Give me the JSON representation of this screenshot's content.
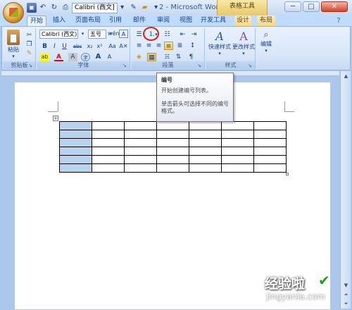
{
  "titlebar": {
    "title": "2 - Microsoft Word",
    "font_name": "Calibri (西文]",
    "context_tools": "表格工具",
    "minimize": "─",
    "maximize": "□",
    "close": "✕"
  },
  "tabs": [
    {
      "label": "开始"
    },
    {
      "label": "插入"
    },
    {
      "label": "页面布局"
    },
    {
      "label": "引用"
    },
    {
      "label": "邮件"
    },
    {
      "label": "审阅"
    },
    {
      "label": "视图"
    },
    {
      "label": "开发工具"
    },
    {
      "label": "设计"
    },
    {
      "label": "布局"
    }
  ],
  "ribbon": {
    "clipboard": {
      "paste": "粘贴",
      "label": "剪贴板"
    },
    "font": {
      "name": "Calibri (西文)",
      "size": "五号",
      "label": "字体"
    },
    "paragraph": {
      "label": "段落"
    },
    "styles": {
      "quick": "快速样式",
      "change": "更改样式",
      "label": "样式"
    },
    "editing": {
      "label": "编辑"
    }
  },
  "tooltip": {
    "title": "编号",
    "line1": "开始创建编号列表。",
    "line2": "单击箭头可选择不同的编号",
    "line3": "格式。"
  },
  "document": {
    "table": {
      "rows": 6,
      "cols": 7
    }
  },
  "watermark": {
    "text": "经验啦",
    "url": "jingyanla.com"
  },
  "colors": {
    "ribbon_bg": "#dbe8f9",
    "selection": "#b8d3f0",
    "annotation": "#d2231f"
  }
}
